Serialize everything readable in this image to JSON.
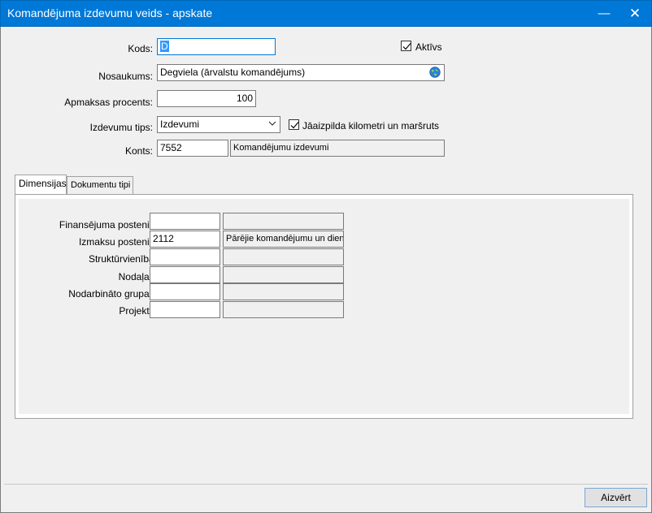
{
  "window": {
    "title": "Komandējuma izdevumu veids - apskate",
    "minimize_glyph": "—",
    "close_glyph": "✕"
  },
  "form": {
    "code_label": "Kods:",
    "code_value": "D",
    "active_label": "Aktīvs",
    "active_checked": true,
    "name_label": "Nosaukums:",
    "name_value": "Degviela (ārvalstu komandējums)",
    "percent_label": "Apmaksas procents:",
    "percent_value": "100",
    "expense_type_label": "Izdevumu tips:",
    "expense_type_value": "Izdevumi",
    "km_route_label": "Jāaizpilda kilometri un maršruts",
    "km_route_checked": true,
    "account_label": "Konts:",
    "account_code": "7552",
    "account_name": "Komandējumu izdevumi"
  },
  "tabs": [
    {
      "label": "Dimensijas",
      "active": true
    },
    {
      "label": "Dokumentu tipi",
      "active": false
    }
  ],
  "dimensions": [
    {
      "label": "Finansējuma postenis:",
      "code": "",
      "name": ""
    },
    {
      "label": "Izmaksu postenis:",
      "code": "2112",
      "name": "Pārējie komandējumu un diene"
    },
    {
      "label": "Struktūrvienība:",
      "code": "",
      "name": ""
    },
    {
      "label": "Nodaļas:",
      "code": "",
      "name": ""
    },
    {
      "label": "Nodarbināto grupas:",
      "code": "",
      "name": ""
    },
    {
      "label": "Projekts:",
      "code": "",
      "name": ""
    }
  ],
  "footer": {
    "close_label": "Aizvērt"
  },
  "colors": {
    "titlebar": "#0078d7",
    "selection": "#3399ff",
    "window_bg": "#f0f0f0"
  },
  "icons": {
    "translate": "globe-icon",
    "dropdown": "chevron-down-icon",
    "check": "checkmark-icon"
  }
}
